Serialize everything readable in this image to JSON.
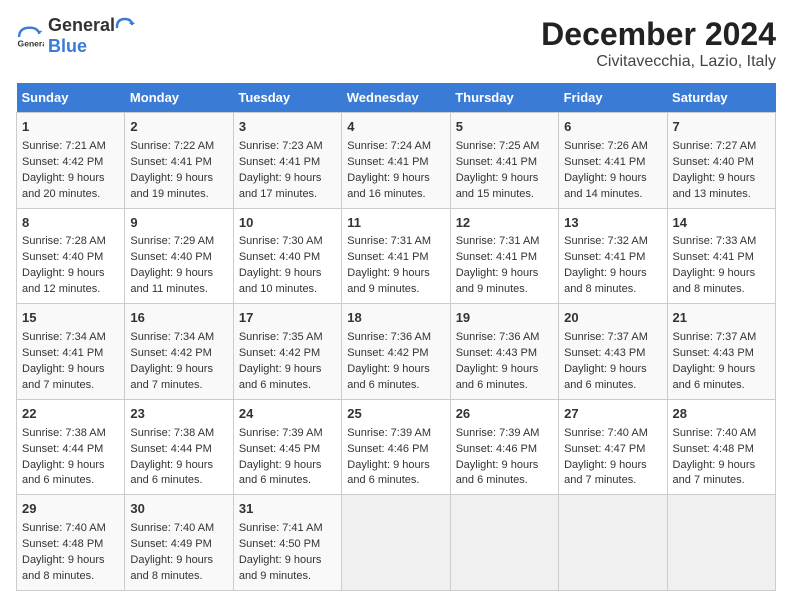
{
  "logo": {
    "text_general": "General",
    "text_blue": "Blue"
  },
  "title": "December 2024",
  "subtitle": "Civitavecchia, Lazio, Italy",
  "days_of_week": [
    "Sunday",
    "Monday",
    "Tuesday",
    "Wednesday",
    "Thursday",
    "Friday",
    "Saturday"
  ],
  "weeks": [
    [
      {
        "day": "1",
        "sunrise": "7:21 AM",
        "sunset": "4:42 PM",
        "daylight": "9 hours and 20 minutes."
      },
      {
        "day": "2",
        "sunrise": "7:22 AM",
        "sunset": "4:41 PM",
        "daylight": "9 hours and 19 minutes."
      },
      {
        "day": "3",
        "sunrise": "7:23 AM",
        "sunset": "4:41 PM",
        "daylight": "9 hours and 17 minutes."
      },
      {
        "day": "4",
        "sunrise": "7:24 AM",
        "sunset": "4:41 PM",
        "daylight": "9 hours and 16 minutes."
      },
      {
        "day": "5",
        "sunrise": "7:25 AM",
        "sunset": "4:41 PM",
        "daylight": "9 hours and 15 minutes."
      },
      {
        "day": "6",
        "sunrise": "7:26 AM",
        "sunset": "4:41 PM",
        "daylight": "9 hours and 14 minutes."
      },
      {
        "day": "7",
        "sunrise": "7:27 AM",
        "sunset": "4:40 PM",
        "daylight": "9 hours and 13 minutes."
      }
    ],
    [
      {
        "day": "8",
        "sunrise": "7:28 AM",
        "sunset": "4:40 PM",
        "daylight": "9 hours and 12 minutes."
      },
      {
        "day": "9",
        "sunrise": "7:29 AM",
        "sunset": "4:40 PM",
        "daylight": "9 hours and 11 minutes."
      },
      {
        "day": "10",
        "sunrise": "7:30 AM",
        "sunset": "4:40 PM",
        "daylight": "9 hours and 10 minutes."
      },
      {
        "day": "11",
        "sunrise": "7:31 AM",
        "sunset": "4:41 PM",
        "daylight": "9 hours and 9 minutes."
      },
      {
        "day": "12",
        "sunrise": "7:31 AM",
        "sunset": "4:41 PM",
        "daylight": "9 hours and 9 minutes."
      },
      {
        "day": "13",
        "sunrise": "7:32 AM",
        "sunset": "4:41 PM",
        "daylight": "9 hours and 8 minutes."
      },
      {
        "day": "14",
        "sunrise": "7:33 AM",
        "sunset": "4:41 PM",
        "daylight": "9 hours and 8 minutes."
      }
    ],
    [
      {
        "day": "15",
        "sunrise": "7:34 AM",
        "sunset": "4:41 PM",
        "daylight": "9 hours and 7 minutes."
      },
      {
        "day": "16",
        "sunrise": "7:34 AM",
        "sunset": "4:42 PM",
        "daylight": "9 hours and 7 minutes."
      },
      {
        "day": "17",
        "sunrise": "7:35 AM",
        "sunset": "4:42 PM",
        "daylight": "9 hours and 6 minutes."
      },
      {
        "day": "18",
        "sunrise": "7:36 AM",
        "sunset": "4:42 PM",
        "daylight": "9 hours and 6 minutes."
      },
      {
        "day": "19",
        "sunrise": "7:36 AM",
        "sunset": "4:43 PM",
        "daylight": "9 hours and 6 minutes."
      },
      {
        "day": "20",
        "sunrise": "7:37 AM",
        "sunset": "4:43 PM",
        "daylight": "9 hours and 6 minutes."
      },
      {
        "day": "21",
        "sunrise": "7:37 AM",
        "sunset": "4:43 PM",
        "daylight": "9 hours and 6 minutes."
      }
    ],
    [
      {
        "day": "22",
        "sunrise": "7:38 AM",
        "sunset": "4:44 PM",
        "daylight": "9 hours and 6 minutes."
      },
      {
        "day": "23",
        "sunrise": "7:38 AM",
        "sunset": "4:44 PM",
        "daylight": "9 hours and 6 minutes."
      },
      {
        "day": "24",
        "sunrise": "7:39 AM",
        "sunset": "4:45 PM",
        "daylight": "9 hours and 6 minutes."
      },
      {
        "day": "25",
        "sunrise": "7:39 AM",
        "sunset": "4:46 PM",
        "daylight": "9 hours and 6 minutes."
      },
      {
        "day": "26",
        "sunrise": "7:39 AM",
        "sunset": "4:46 PM",
        "daylight": "9 hours and 6 minutes."
      },
      {
        "day": "27",
        "sunrise": "7:40 AM",
        "sunset": "4:47 PM",
        "daylight": "9 hours and 7 minutes."
      },
      {
        "day": "28",
        "sunrise": "7:40 AM",
        "sunset": "4:48 PM",
        "daylight": "9 hours and 7 minutes."
      }
    ],
    [
      {
        "day": "29",
        "sunrise": "7:40 AM",
        "sunset": "4:48 PM",
        "daylight": "9 hours and 8 minutes."
      },
      {
        "day": "30",
        "sunrise": "7:40 AM",
        "sunset": "4:49 PM",
        "daylight": "9 hours and 8 minutes."
      },
      {
        "day": "31",
        "sunrise": "7:41 AM",
        "sunset": "4:50 PM",
        "daylight": "9 hours and 9 minutes."
      },
      null,
      null,
      null,
      null
    ]
  ]
}
